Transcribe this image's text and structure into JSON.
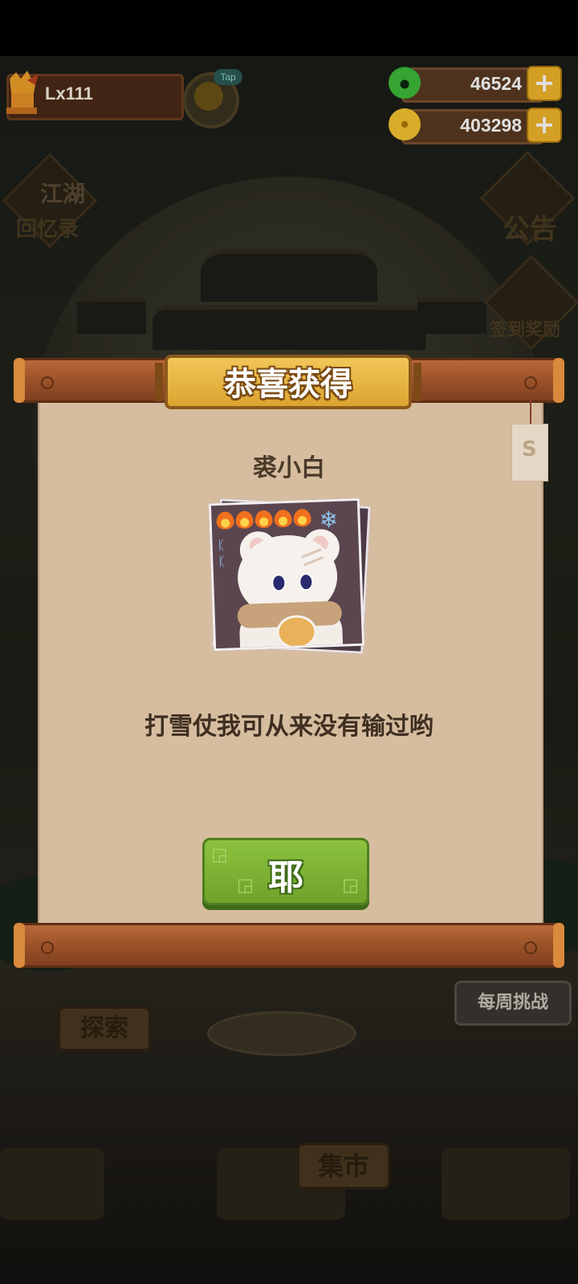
{
  "hud": {
    "player_name": "Lx111",
    "tap_badge": "Tap",
    "jade_amount": "46524",
    "coin_amount": "403298",
    "plus_symbol": "+"
  },
  "background": {
    "left_menu_label": "回忆录",
    "left_menu_sign": "江湖",
    "notice_label": "公告",
    "signin_label": "签到奖励",
    "explore_label": "探索",
    "market_label": "集市",
    "weekly_label": "每周挑战"
  },
  "modal": {
    "title": "恭喜获得",
    "reward_name": "裘小白",
    "reward_desc": "打雪仗我可从来没有输过哟",
    "confirm_label": "耶",
    "tag_glyph": "S",
    "flame_count": 5
  },
  "colors": {
    "rod": "#9b5228",
    "paper": "#d6bd9f",
    "title_plate": "#f1c658",
    "confirm_button": "#8cc23f"
  }
}
